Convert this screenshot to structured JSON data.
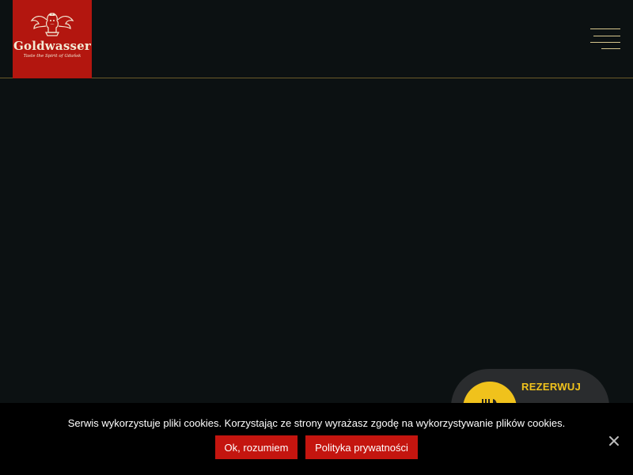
{
  "header": {
    "logo": {
      "name": "Goldwasser",
      "tagline": "Taste the Spirit of Gdańsk",
      "icon": "crest-icon",
      "color": "#b3160f"
    },
    "menu_icon": "hamburger-menu-icon"
  },
  "reserve": {
    "label": "REZERWUJ",
    "icon": "cutlery-icon",
    "accent": "#f0c21c"
  },
  "cookie": {
    "message": "Serwis wykorzystuje pliki cookies. Korzystając ze strony wyrażasz zgodę na wykorzystywanie plików cookies.",
    "accept_label": "Ok, rozumiem",
    "policy_label": "Polityka prywatności",
    "close_icon": "close-icon",
    "button_color": "#c4150f"
  }
}
